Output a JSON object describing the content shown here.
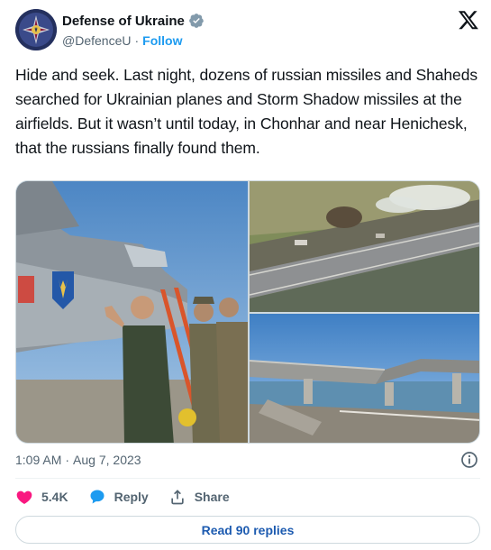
{
  "account": {
    "name": "Defense of Ukraine",
    "handle": "@DefenceU",
    "separator": "·",
    "follow_label": "Follow"
  },
  "tweet": {
    "text": "Hide and seek. Last night, dozens of russian missiles and Shaheds searched for Ukrainian planes and Storm Shadow missiles at the airfields. But it wasn’t until today, in Chonhar and near Henichesk, that the russians finally found them."
  },
  "media": {
    "images": [
      {
        "icon": "photo-soldiers-signing-jet"
      },
      {
        "icon": "photo-aerial-damaged-bridge"
      },
      {
        "icon": "photo-collapsed-bridge"
      }
    ]
  },
  "meta": {
    "time": "1:09 AM",
    "separator": "·",
    "date": "Aug 7, 2023"
  },
  "actions": {
    "likes": "5.4K",
    "reply_label": "Reply",
    "share_label": "Share"
  },
  "replies_button": "Read 90 replies",
  "colors": {
    "accent": "#1d9bf0",
    "like": "#f91880",
    "reply_icon": "#1d9bf0",
    "secondary_text": "#536471",
    "replies_text": "#1d5bb0"
  }
}
